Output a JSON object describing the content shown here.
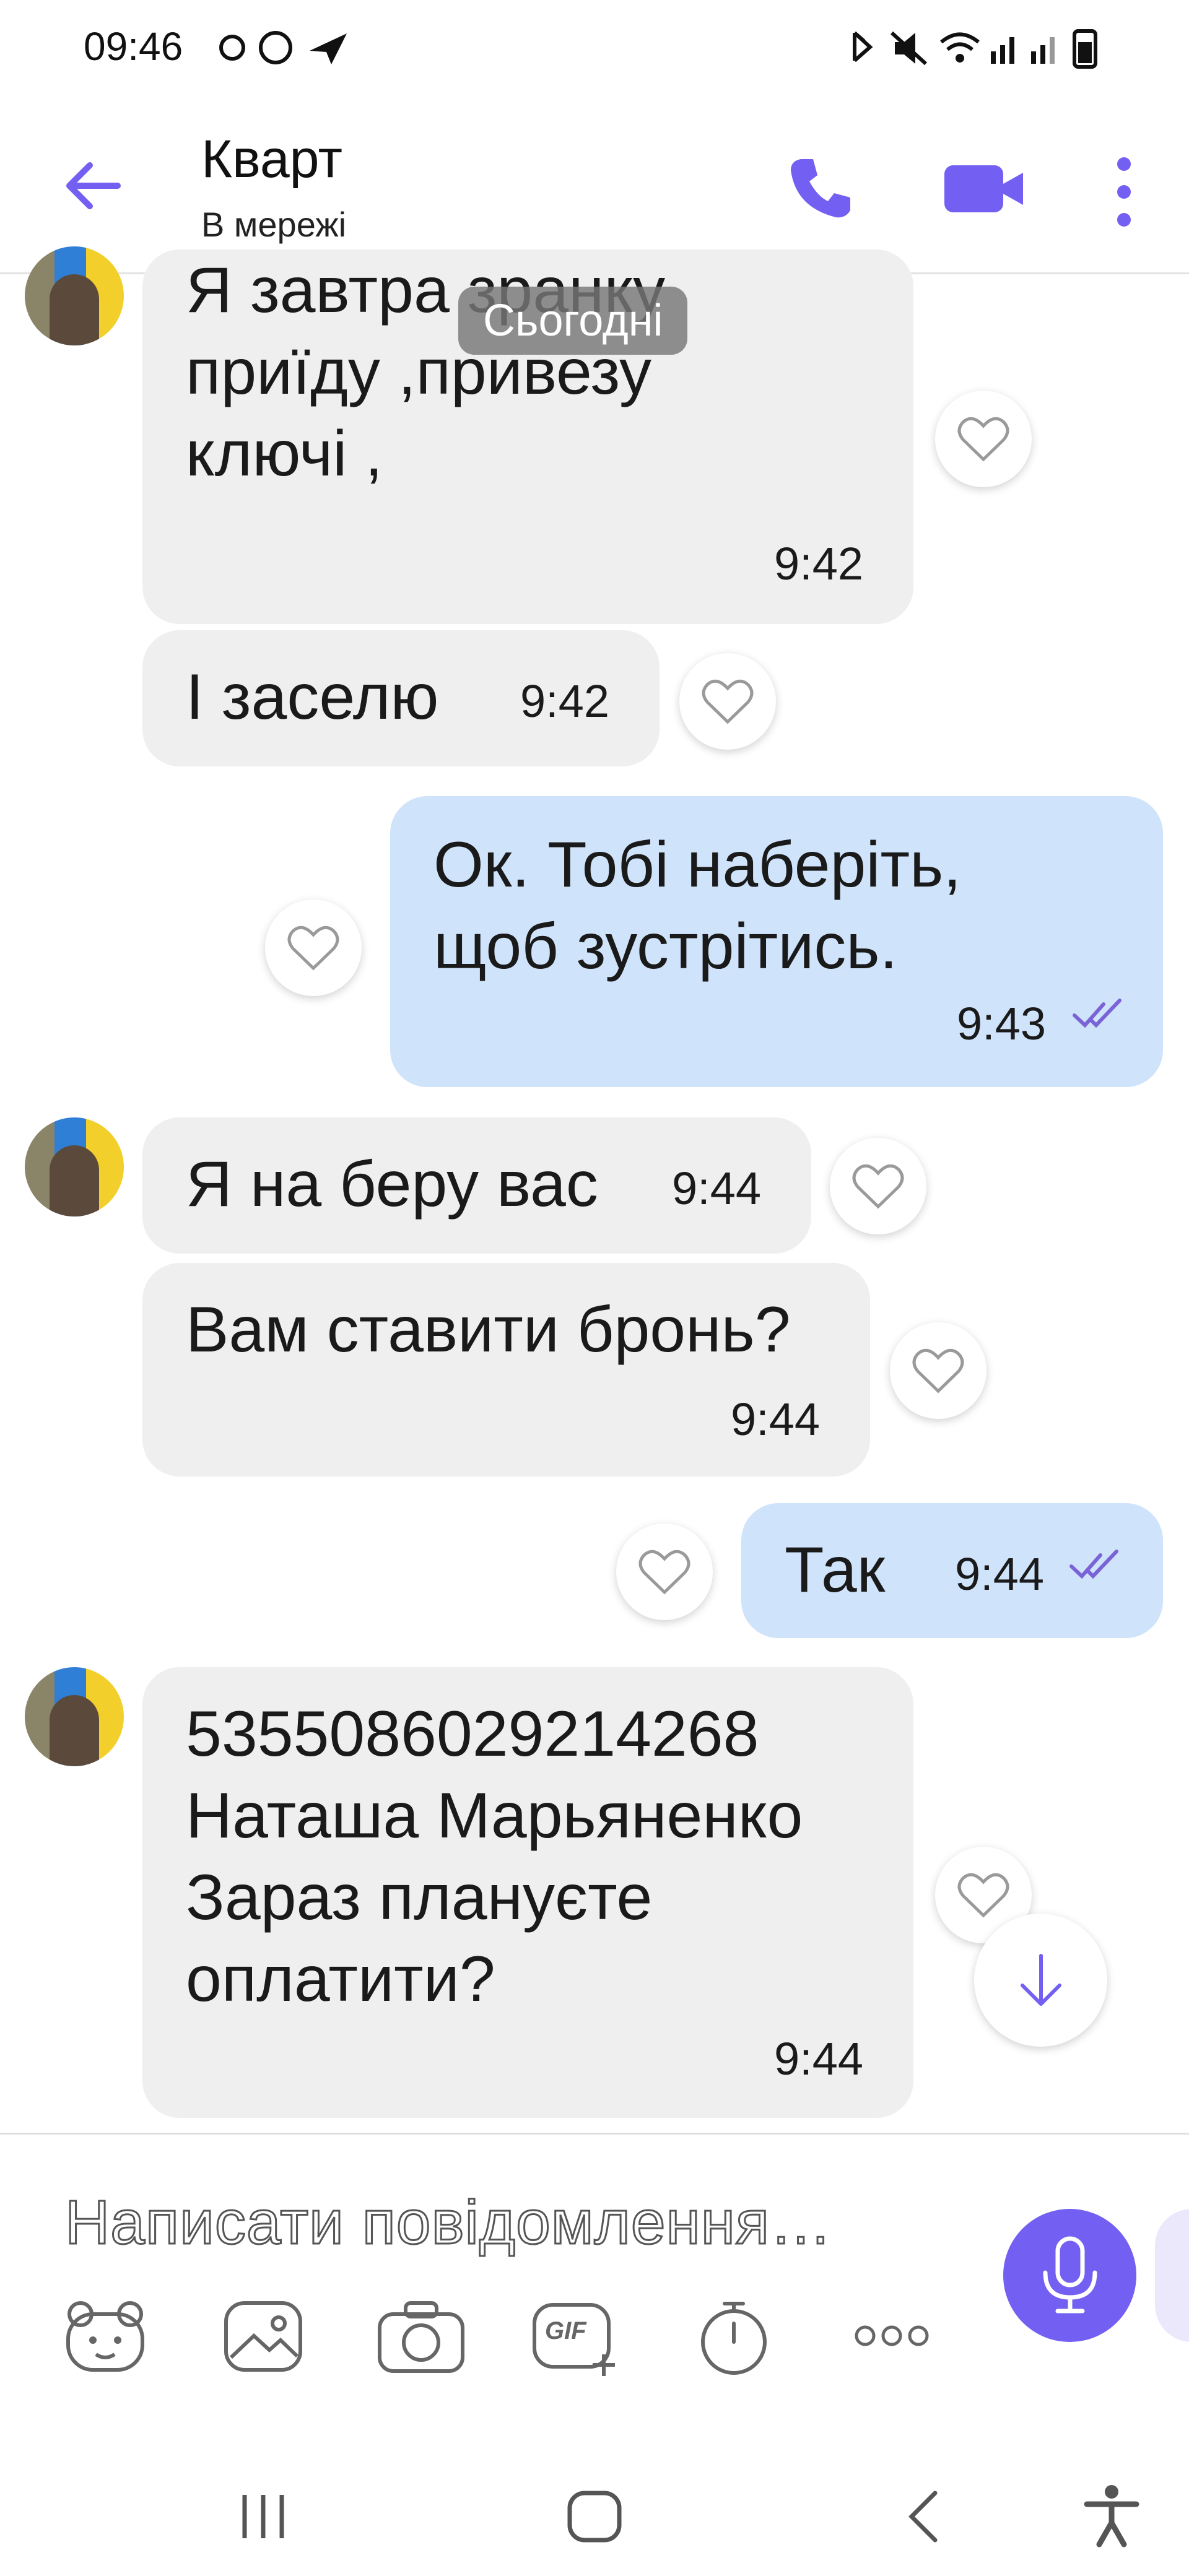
{
  "status_bar": {
    "time": "09:46"
  },
  "header": {
    "contact_name": "Кварт",
    "contact_status": "В мережі"
  },
  "date_chip": "Сьогодні",
  "messages": [
    {
      "text": "Я завтра зранку\nприїду ,привезу\nключі ,",
      "time": "9:42"
    },
    {
      "text": "І заселю",
      "time": "9:42"
    },
    {
      "text": "Ок. Тобі  наберіть,\nщоб зустрітись.",
      "time": "9:43"
    },
    {
      "text": "Я на беру вас",
      "time": "9:44"
    },
    {
      "text": "Вам ставити бронь?",
      "time": "9:44"
    },
    {
      "text": "Так",
      "time": "9:44"
    },
    {
      "text": "5355086029214268\nНаташа Марьяненко\nЗараз плануєте\nоплатити?",
      "time": "9:44"
    }
  ],
  "composer": {
    "placeholder": "Написати повідомлення…",
    "gif_label": "GIF"
  },
  "colors": {
    "accent": "#7360f2",
    "incoming_bubble": "#efefef",
    "outgoing_bubble": "#cfe3fb"
  },
  "icons": [
    "back-arrow-icon",
    "phone-icon",
    "video-icon",
    "more-icon",
    "heart-icon",
    "scroll-down-icon",
    "mic-icon",
    "sticker-icon",
    "gallery-icon",
    "camera-icon",
    "gif-icon",
    "timer-icon",
    "more-options-icon"
  ]
}
